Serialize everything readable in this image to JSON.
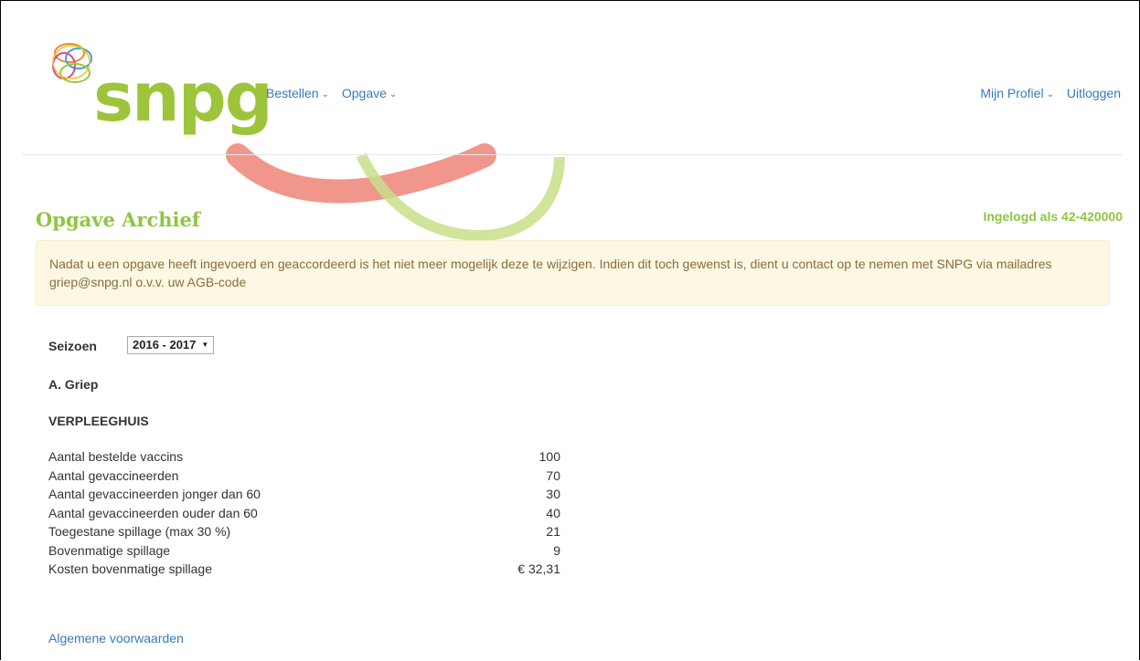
{
  "brand": {
    "logo_text": "snpg",
    "green": "#9ec43b",
    "link": "#3a79b8"
  },
  "nav": {
    "left": [
      {
        "label": "Bestellen"
      },
      {
        "label": "Opgave"
      }
    ],
    "right": {
      "profile": "Mijn Profiel",
      "logout": "Uitloggen"
    }
  },
  "page": {
    "title": "Opgave Archief",
    "logged_in": "Ingelogd als 42-420000",
    "alert": "Nadat u een opgave heeft ingevoerd en geaccordeerd is het niet meer mogelijk deze te wijzigen. Indien dit toch gewenst is, dient u contact op te nemen met SNPG via mailadres griep@snpg.nl o.v.v. uw AGB-code"
  },
  "season": {
    "label": "Seizoen",
    "selected": "2016 - 2017"
  },
  "section": {
    "name": "A. Griep",
    "category": "VERPLEEGHUIS"
  },
  "stats": [
    {
      "label": "Aantal bestelde vaccins",
      "value": "100"
    },
    {
      "label": "Aantal gevaccineerden",
      "value": "70"
    },
    {
      "label": "Aantal gevaccineerden jonger dan 60",
      "value": "30"
    },
    {
      "label": "Aantal gevaccineerden ouder dan 60",
      "value": "40"
    },
    {
      "label": "Toegestane spillage (max 30 %)",
      "value": "21"
    },
    {
      "label": "Bovenmatige spillage",
      "value": "9"
    },
    {
      "label": "Kosten bovenmatige spillage",
      "value": "€ 32,31"
    }
  ],
  "footer": {
    "terms": "Algemene voorwaarden"
  }
}
